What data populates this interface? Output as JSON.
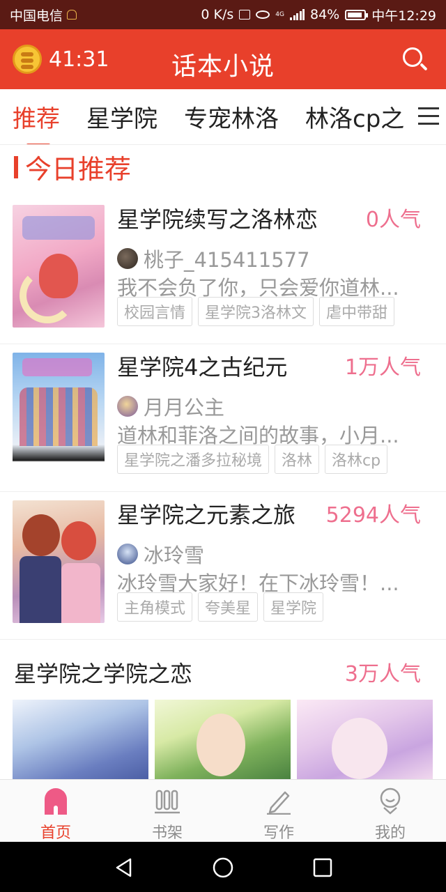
{
  "status_bar": {
    "carrier": "中国电信",
    "net_speed": "0 K/s",
    "network_label": "4G",
    "battery": "84%",
    "time": "中午12:29"
  },
  "header": {
    "timer": "41:31",
    "title": "话本小说"
  },
  "tabs": [
    "推荐",
    "星学院",
    "专宠林洛",
    "林洛cp之"
  ],
  "section": {
    "title": "今日推荐"
  },
  "books": [
    {
      "title": "星学院续写之洛林恋",
      "popularity": "0人气",
      "author": "桃子_415411577",
      "description": "我不会负了你，只会爱你道林...",
      "tags": [
        "校园言情",
        "星学院3洛林文",
        "虐中带甜"
      ]
    },
    {
      "title": "星学院4之古纪元",
      "popularity": "1万人气",
      "author": "月月公主",
      "description": "道林和菲洛之间的故事，小月...",
      "tags": [
        "星学院之潘多拉秘境",
        "洛林",
        "洛林cp"
      ]
    },
    {
      "title": "星学院之元素之旅",
      "popularity": "5294人气",
      "author": "冰玲雪",
      "description": "冰玲雪大家好！在下冰玲雪！...",
      "tags": [
        "主角模式",
        "夸美星",
        "星学院"
      ]
    }
  ],
  "featured": {
    "title": "星学院之学院之恋",
    "popularity": "3万人气"
  },
  "bottom_nav": [
    {
      "label": "首页",
      "icon": "home-icon"
    },
    {
      "label": "书架",
      "icon": "bookshelf-icon"
    },
    {
      "label": "写作",
      "icon": "pencil-icon"
    },
    {
      "label": "我的",
      "icon": "profile-icon"
    }
  ],
  "colors": {
    "accent": "#e8402b",
    "popularity": "#ee6f8e",
    "status_bar": "#5a1a14"
  }
}
